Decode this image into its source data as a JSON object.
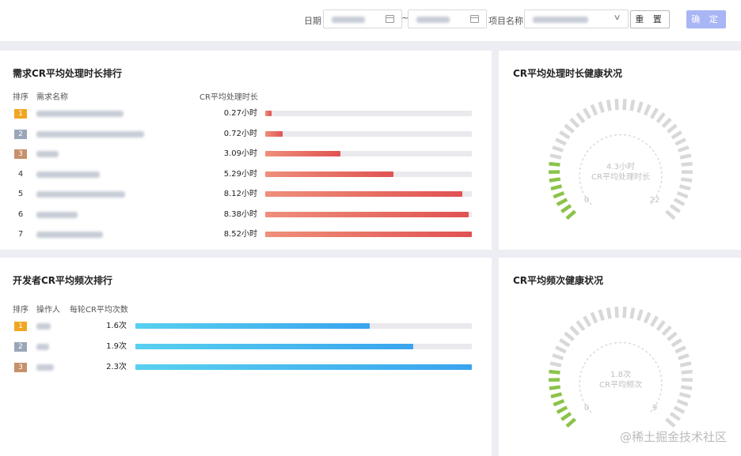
{
  "filters": {
    "date_label": "日期",
    "date_separator": "~",
    "project_label": "项目名称",
    "reset_label": "重 置",
    "confirm_label": "确 定"
  },
  "cr_duration_rank": {
    "title": "需求CR平均处理时长排行",
    "col_rank": "排序",
    "col_name": "需求名称",
    "col_value": "CR平均处理时长",
    "max": 8.52,
    "rows": [
      {
        "rank": "1",
        "value": "0.27小时",
        "amount": 0.27,
        "badge": "#f0a623"
      },
      {
        "rank": "2",
        "value": "0.72小时",
        "amount": 0.72,
        "badge": "#9aa6b8"
      },
      {
        "rank": "3",
        "value": "3.09小时",
        "amount": 3.09,
        "badge": "#c6906a"
      },
      {
        "rank": "4",
        "value": "5.29小时",
        "amount": 5.29,
        "badge": ""
      },
      {
        "rank": "5",
        "value": "8.12小时",
        "amount": 8.12,
        "badge": ""
      },
      {
        "rank": "6",
        "value": "8.38小时",
        "amount": 8.38,
        "badge": ""
      },
      {
        "rank": "7",
        "value": "8.52小时",
        "amount": 8.52,
        "badge": ""
      }
    ]
  },
  "dev_frequency_rank": {
    "title": "开发者CR平均频次排行",
    "col_rank": "排序",
    "col_name": "操作人",
    "col_value": "每轮CR平均次数",
    "max": 2.3,
    "rows": [
      {
        "rank": "1",
        "value": "1.6次",
        "amount": 1.6,
        "badge": "#f0a623"
      },
      {
        "rank": "2",
        "value": "1.9次",
        "amount": 1.9,
        "badge": "#9aa6b8"
      },
      {
        "rank": "3",
        "value": "2.3次",
        "amount": 2.3,
        "badge": "#c6906a"
      }
    ]
  },
  "duration_gauge": {
    "title": "CR平均处理时长健康状况",
    "value_text": "4.3小时",
    "caption": "CR平均处理时长",
    "min_label": "0",
    "max_label": "22",
    "value": 4.3,
    "min": 0,
    "max": 22
  },
  "frequency_gauge": {
    "title": "CR平均频次健康状况",
    "value_text": "1.8次",
    "caption": "CR平均频次",
    "min_label": "0",
    "max_label": "9",
    "value": 1.8,
    "min": 0,
    "max": 9
  },
  "watermark": "@稀土掘金技术社区",
  "colors": {
    "accent_green": "#8bc34a",
    "inactive_tick": "#d8d8d8",
    "confirm_button": "#a9b6f5"
  }
}
